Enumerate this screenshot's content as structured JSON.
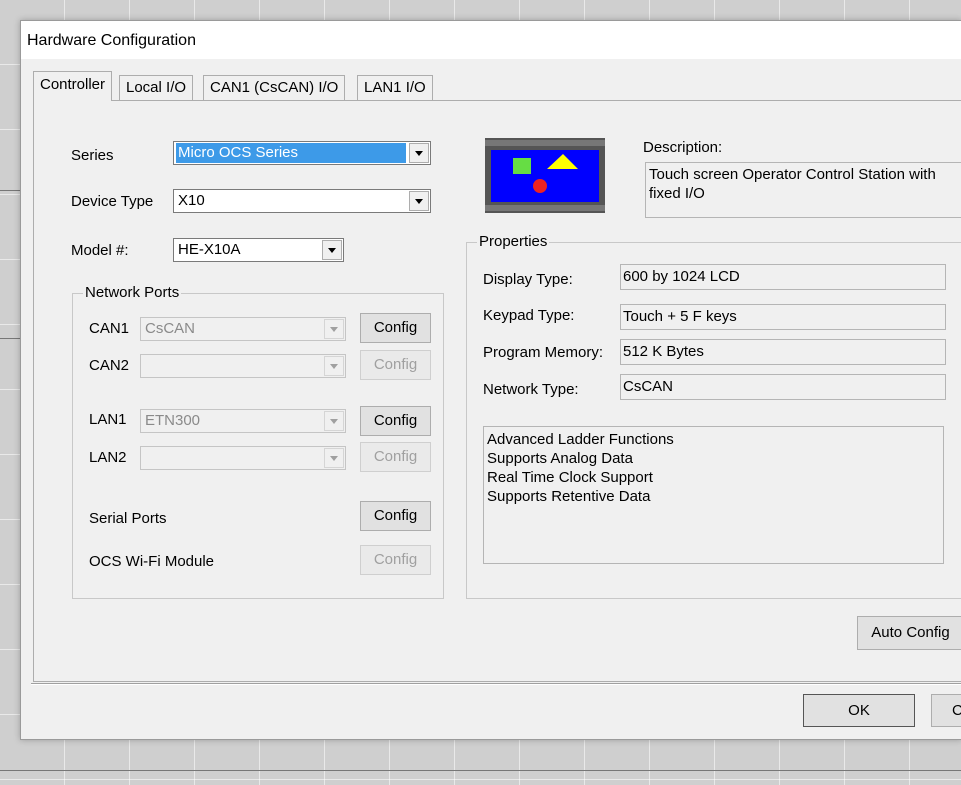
{
  "dialog": {
    "title": "Hardware Configuration"
  },
  "tabs": [
    {
      "label": "Controller",
      "active": true
    },
    {
      "label": "Local I/O",
      "active": false
    },
    {
      "label": "CAN1 (CsCAN) I/O",
      "active": false
    },
    {
      "label": "LAN1 I/O",
      "active": false
    }
  ],
  "controller": {
    "series_label": "Series",
    "series_value": "Micro OCS Series",
    "device_type_label": "Device Type",
    "device_type_value": "X10",
    "model_label": "Model #:",
    "model_value": "HE-X10A"
  },
  "network_ports": {
    "title": "Network Ports",
    "can1_label": "CAN1",
    "can1_value": "CsCAN",
    "can2_label": "CAN2",
    "can2_value": "",
    "lan1_label": "LAN1",
    "lan1_value": "ETN300",
    "lan2_label": "LAN2",
    "lan2_value": "",
    "serial_label": "Serial Ports",
    "wifi_label": "OCS Wi-Fi Module",
    "config_label": "Config"
  },
  "description": {
    "label": "Description:",
    "text": "Touch screen Operator Control Station with fixed I/O"
  },
  "properties": {
    "title": "Properties",
    "display_type_label": "Display Type:",
    "display_type_value": "600 by 1024 LCD",
    "keypad_type_label": "Keypad Type:",
    "keypad_type_value": "Touch + 5 F keys",
    "program_memory_label": "Program Memory:",
    "program_memory_value": "512 K Bytes",
    "network_type_label": "Network Type:",
    "network_type_value": "CsCAN",
    "features": [
      "Advanced Ladder Functions",
      "Supports Analog Data",
      "Real Time Clock Support",
      "Supports Retentive Data"
    ]
  },
  "buttons": {
    "auto_config": "Auto Config",
    "ok": "OK",
    "cancel_partial": "C"
  },
  "colors": {
    "selection": "#3d9ae8",
    "device_screen": "#0000ff",
    "icon_square": "#66dd44",
    "icon_triangle": "#ffff00",
    "icon_circle": "#ee2222"
  },
  "icons": {
    "device_image": "ocs-device-icon"
  }
}
